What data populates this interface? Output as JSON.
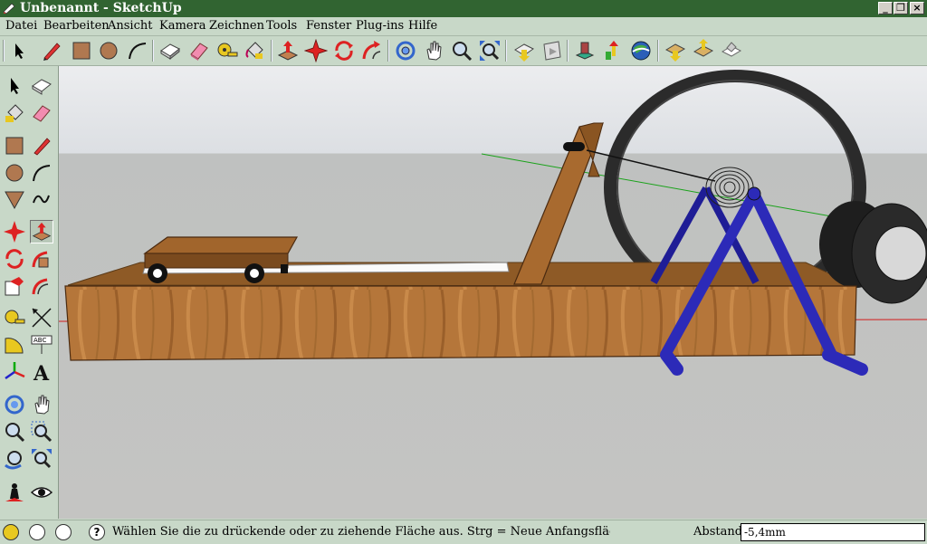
{
  "window": {
    "title": "Unbenannt - SketchUp"
  },
  "menu": [
    "Datei",
    "Bearbeiten",
    "Ansicht",
    "Kamera",
    "Zeichnen",
    "Tools",
    "Fenster",
    "Plug-ins",
    "Hilfe"
  ],
  "toolbar_icons": [
    "select-icon",
    "pencil-icon",
    "rectangle-icon",
    "circle-icon",
    "arc-icon",
    "make-component-icon",
    "eraser-icon",
    "tape-measure-icon",
    "paint-bucket-icon",
    "push-pull-icon",
    "move-icon",
    "rotate-icon",
    "follow-me-icon",
    "orbit-icon",
    "pan-icon",
    "zoom-icon",
    "zoom-extents-icon",
    "get-models-icon",
    "share-model-icon",
    "get-components-icon",
    "share-component-icon",
    "google-earth-icon",
    "preview-earth-icon",
    "toggle-terrain-icon",
    "place-model-icon"
  ],
  "sidebar_icons": [
    "select-icon",
    "make-component-icon",
    "paint-bucket-icon",
    "eraser-icon",
    "rectangle-icon",
    "line-icon",
    "circle-icon",
    "arc-icon",
    "polygon-icon",
    "freehand-icon",
    "move-icon",
    "push-pull-icon",
    "rotate-icon",
    "follow-me-icon",
    "scale-icon",
    "offset-icon",
    "tape-measure-icon",
    "dimension-icon",
    "protractor-icon",
    "text-icon",
    "axes-icon",
    "3d-text-icon",
    "orbit-icon",
    "pan-icon",
    "zoom-icon",
    "zoom-window-icon",
    "previous-view-icon",
    "zoom-extents-icon",
    "position-camera-icon",
    "look-around-icon"
  ],
  "status": {
    "message": "Wählen Sie die zu drückende oder zu ziehende Fläche aus. Strg = Neue Anfangsfläche erstellen ein/aus",
    "measure_label": "Abstand",
    "measure_value": "-5,4mm"
  },
  "colors": {
    "title_bar": "#316431",
    "chrome": "#c8d8c8",
    "wood": "#a86a2f",
    "frame_blue": "#2c2ab8",
    "wheel_dark": "#2a2a2a"
  }
}
